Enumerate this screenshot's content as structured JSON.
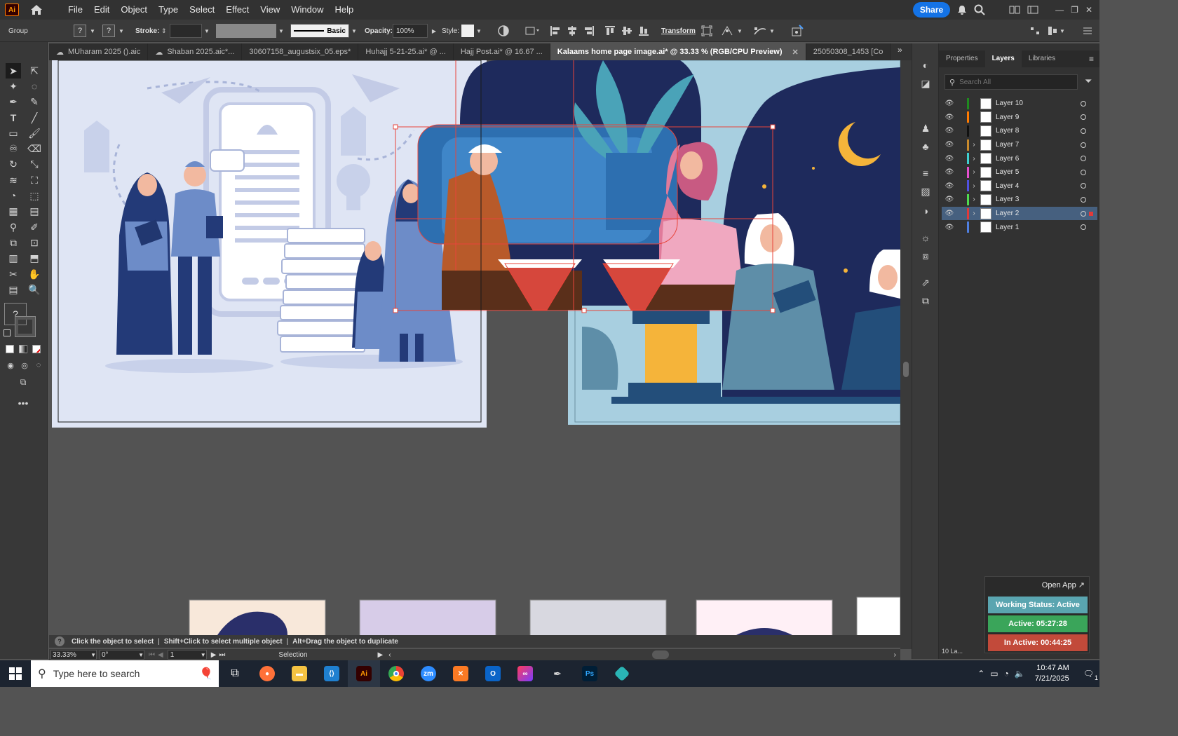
{
  "app": {
    "logo": "Ai",
    "menus": [
      "File",
      "Edit",
      "Object",
      "Type",
      "Select",
      "Effect",
      "View",
      "Window",
      "Help"
    ],
    "share": "Share"
  },
  "control": {
    "selection_type": "Group",
    "fill_glyph": "?",
    "stroke_glyph": "?",
    "stroke_label": "Stroke:",
    "brush": "Basic",
    "opacity_label": "Opacity:",
    "opacity_value": "100%",
    "style_label": "Style:",
    "transform": "Transform"
  },
  "tabs": [
    {
      "label": "MUharam 2025 ().aic"
    },
    {
      "label": "Shaban 2025.aic*..."
    },
    {
      "label": "30607158_augustsix_05.eps*"
    },
    {
      "label": "Huhajj 5-21-25.ai* @ ..."
    },
    {
      "label": "Hajj Post.ai* @ 16.67 ..."
    },
    {
      "label": "Kalaams home page image.ai* @ 33.33 % (RGB/CPU Preview)"
    },
    {
      "label": "25050308_1453 [Co"
    }
  ],
  "panel": {
    "tabs": [
      "Properties",
      "Layers",
      "Libraries"
    ],
    "search_placeholder": "Search All",
    "layers": [
      {
        "name": "Layer 10",
        "color": "#1f8a1f",
        "has_children": false,
        "selected": false
      },
      {
        "name": "Layer 9",
        "color": "#ff7a00",
        "has_children": false,
        "selected": false
      },
      {
        "name": "Layer 8",
        "color": "#111111",
        "has_children": false,
        "selected": false
      },
      {
        "name": "Layer 7",
        "color": "#c98a2c",
        "has_children": true,
        "selected": false
      },
      {
        "name": "Layer 6",
        "color": "#3fd0d0",
        "has_children": true,
        "selected": false
      },
      {
        "name": "Layer 5",
        "color": "#e64fd0",
        "has_children": true,
        "selected": false
      },
      {
        "name": "Layer 4",
        "color": "#5050e0",
        "has_children": true,
        "selected": false
      },
      {
        "name": "Layer 3",
        "color": "#4fdc4f",
        "has_children": true,
        "selected": false
      },
      {
        "name": "Layer 2",
        "color": "#e03a3a",
        "has_children": true,
        "selected": true
      },
      {
        "name": "Layer 1",
        "color": "#4f7fe0",
        "has_children": false,
        "selected": false
      }
    ],
    "footer": "10 La..."
  },
  "status": {
    "hint1": "Click the object to select",
    "hint2": "Shift+Click to select multiple object",
    "hint3": "Alt+Drag the object to duplicate",
    "zoom": "33.33%",
    "rotation": "0°",
    "artboard": "1",
    "tool": "Selection"
  },
  "widget": {
    "open_app": "Open App ↗",
    "working": "Working Status: Active",
    "active": "Active: 05:27:28",
    "inactive": "In Active: 00:44:25",
    "colors": {
      "working": "#5aa5b0",
      "active": "#3aa55a",
      "inactive": "#c24a3a"
    }
  },
  "taskbar": {
    "search_placeholder": "Type here to search",
    "time": "10:47 AM",
    "date": "7/21/2025",
    "notif": "1"
  }
}
